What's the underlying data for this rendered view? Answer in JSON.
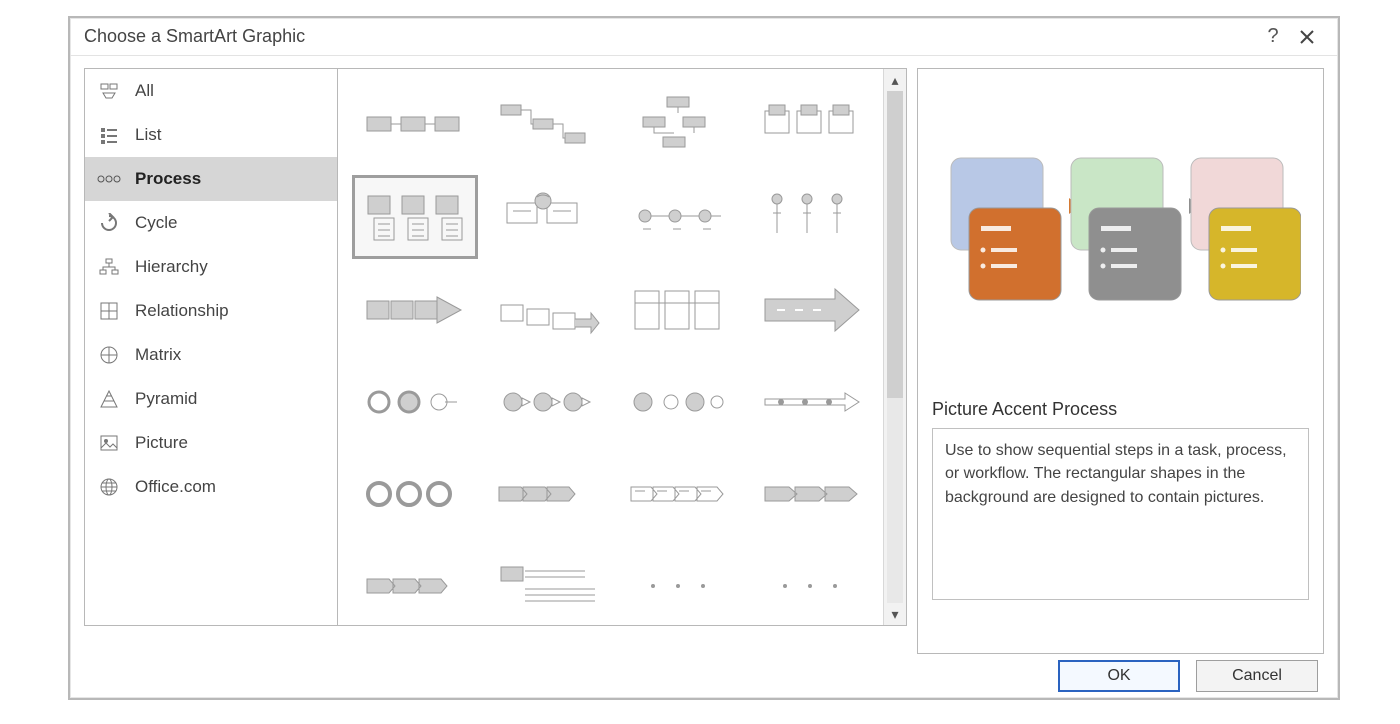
{
  "dialog": {
    "title": "Choose a SmartArt Graphic",
    "help_tooltip": "?",
    "close_tooltip": "×"
  },
  "categories": [
    {
      "icon": "all",
      "label": "All",
      "selected": false
    },
    {
      "icon": "list",
      "label": "List",
      "selected": false
    },
    {
      "icon": "process",
      "label": "Process",
      "selected": true
    },
    {
      "icon": "cycle",
      "label": "Cycle",
      "selected": false
    },
    {
      "icon": "hierarchy",
      "label": "Hierarchy",
      "selected": false
    },
    {
      "icon": "relationship",
      "label": "Relationship",
      "selected": false
    },
    {
      "icon": "matrix",
      "label": "Matrix",
      "selected": false
    },
    {
      "icon": "pyramid",
      "label": "Pyramid",
      "selected": false
    },
    {
      "icon": "picture",
      "label": "Picture",
      "selected": false
    },
    {
      "icon": "officecom",
      "label": "Office.com",
      "selected": false
    }
  ],
  "gallery": {
    "selected_index": 4,
    "thumbs": [
      "basic-process",
      "step-down-process",
      "descending-process",
      "picture-strip-process",
      "picture-accent-process",
      "alternating-picture-blocks",
      "circle-accent-timeline",
      "vertical-accent-list",
      "block-process-arrow",
      "staggered-process",
      "segmented-process",
      "arrow-process",
      "circle-process",
      "chevron-circles",
      "connected-circles",
      "timeline-arrow",
      "ring-process",
      "chevron-list",
      "chevron-accent",
      "basic-chevron",
      "closed-chevron",
      "detailed-process",
      "dots-a",
      "dots-b"
    ]
  },
  "preview": {
    "name": "Picture Accent Process",
    "description": "Use to show sequential steps in a task, process, or workflow. The rectangular shapes in the background are designed to contain pictures.",
    "swatches": [
      {
        "back": "#b8c8e6",
        "front": "#d1702e"
      },
      {
        "back": "#c9e6c6",
        "front": "#8f8f8f"
      },
      {
        "back": "#f1d8d8",
        "front": "#d6b62a"
      }
    ]
  },
  "buttons": {
    "ok": "OK",
    "cancel": "Cancel"
  }
}
